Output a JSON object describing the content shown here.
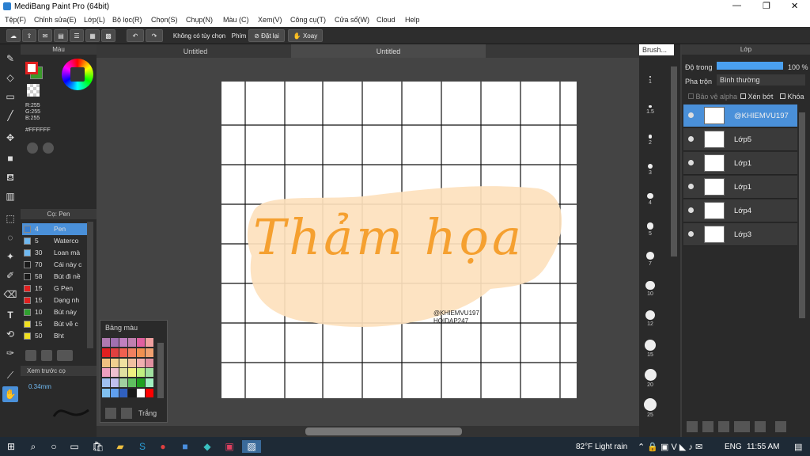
{
  "window": {
    "title": "MediBang Paint Pro (64bit)",
    "minimize": "—",
    "maximize": "❐",
    "close": "✕"
  },
  "menu": [
    "Tệp(F)",
    "Chỉnh sửa(E)",
    "Lớp(L)",
    "Bộ lọc(R)",
    "Chọn(S)",
    "Chụp(N)",
    "Màu (C)",
    "Xem(V)",
    "Công cụ(T)",
    "Cửa sổ(W)",
    "Cloud",
    "Help"
  ],
  "toolbar": {
    "no_option": "Không có tùy chọn",
    "key_label": "Phím",
    "reset": "Đặt lại",
    "rotate": "Xoay"
  },
  "color_panel": {
    "title": "Màu",
    "r": "R:255",
    "g": "G:255",
    "b": "B:255",
    "hex": "#FFFFFF",
    "fg": "#e02020",
    "bg": "#3a9a2a"
  },
  "brush_panel": {
    "title": "Cọ: Pen",
    "items": [
      {
        "size": "4",
        "name": "Pen",
        "color": "#3a7fd0",
        "selected": true
      },
      {
        "size": "5",
        "name": "Waterco",
        "color": "#6fb8f0",
        "selected": false
      },
      {
        "size": "30",
        "name": "Loan mà",
        "color": "#6fb8f0",
        "selected": false
      },
      {
        "size": "70",
        "name": "Cái này c",
        "color": "#1a1a1a",
        "selected": false
      },
      {
        "size": "58",
        "name": "Bút đi nề",
        "color": "#1a1a1a",
        "selected": false
      },
      {
        "size": "15",
        "name": "G Pen",
        "color": "#e02020",
        "selected": false
      },
      {
        "size": "15",
        "name": "Dạng nh",
        "color": "#e02020",
        "selected": false
      },
      {
        "size": "10",
        "name": "Bút này",
        "color": "#30a030",
        "selected": false
      },
      {
        "size": "15",
        "name": "Bút vẽ c",
        "color": "#f0e020",
        "selected": false
      },
      {
        "size": "50",
        "name": "Bht",
        "color": "#f0e020",
        "selected": false
      }
    ]
  },
  "preview": {
    "title": "Xem trước cọ",
    "size": "0.34mm"
  },
  "tabs": [
    "Untitled",
    "Untitled"
  ],
  "artwork": {
    "headline": "Thảm họa",
    "credit1": "@KHIEMVU197",
    "credit2": "HOIDAP247"
  },
  "palette": {
    "title": "Bảng màu",
    "white_label": "Trắng",
    "colors": [
      "#b07ab0",
      "#a070b0",
      "#c080c0",
      "#c080b0",
      "#e060a0",
      "#f0a0a0",
      "#e02020",
      "#e04040",
      "#f06050",
      "#f08060",
      "#f09050",
      "#f0a070",
      "#f0c080",
      "#f0d090",
      "#f0e0a0",
      "#f0c0a0",
      "#f0b0b0",
      "#e090a0",
      "#f0a0c0",
      "#f0c0d0",
      "#e0e0a0",
      "#f0f080",
      "#c0f080",
      "#a0e0a0",
      "#a0c0f0",
      "#c0c0f0",
      "#a0d0a0",
      "#60c060",
      "#20a020",
      "#a0f0c0",
      "#80c0f0",
      "#60a0f0",
      "#3060c0",
      "#1a1a1a",
      "#ffffff",
      "#ff0000"
    ]
  },
  "brush_sizes": [
    "1",
    "1.5",
    "2",
    "3",
    "4",
    "5",
    "7",
    "10",
    "12",
    "15",
    "20",
    "25"
  ],
  "layer_panel": {
    "title": "Lớp",
    "opacity_label": "Độ trong",
    "opacity_value": "100 %",
    "blend_label": "Pha trộn",
    "blend_value": "Bình thường",
    "protect_alpha": "Bảo vệ alpha",
    "clip": "Xén bớt",
    "lock": "Khóa",
    "layers": [
      {
        "name": "@KHIEMVU197",
        "selected": true
      },
      {
        "name": "Lớp5",
        "selected": false
      },
      {
        "name": "Lớp1",
        "selected": false
      },
      {
        "name": "Lớp1",
        "selected": false
      },
      {
        "name": "Lớp4",
        "selected": false
      },
      {
        "name": "Lớp3",
        "selected": false
      }
    ]
  },
  "brush_panel_tab": "Brush...",
  "taskbar": {
    "weather": "82°F  Light rain",
    "lang": "ENG",
    "time": "11:55 AM"
  }
}
